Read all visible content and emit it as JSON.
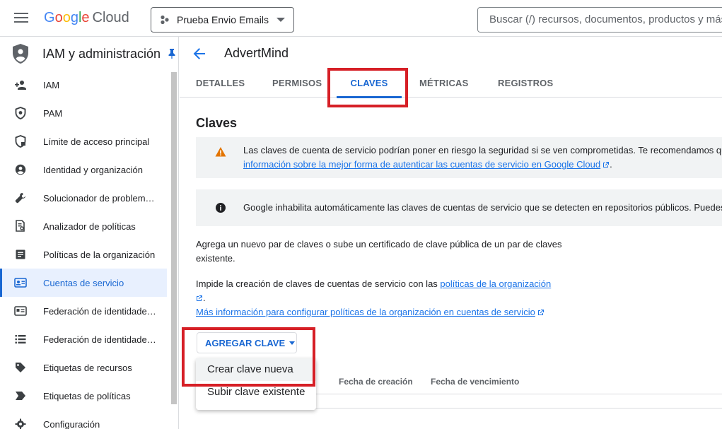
{
  "header": {
    "logo_letters": [
      "G",
      "o",
      "o",
      "g",
      "l",
      "e"
    ],
    "logo_product": "Cloud",
    "project_name": "Prueba Envio Emails",
    "search_placeholder": "Buscar (/) recursos, documentos, productos y más"
  },
  "sidebar": {
    "title": "IAM y administración",
    "items": [
      {
        "label": "IAM",
        "icon": "person-add-icon"
      },
      {
        "label": "PAM",
        "icon": "shield-check-icon"
      },
      {
        "label": "Límite de acceso principal",
        "icon": "shield-lock-icon"
      },
      {
        "label": "Identidad y organización",
        "icon": "account-circle-icon"
      },
      {
        "label": "Solucionador de problemas de políticas",
        "icon": "wrench-icon"
      },
      {
        "label": "Analizador de políticas",
        "icon": "document-search-icon"
      },
      {
        "label": "Políticas de la organización",
        "icon": "list-document-icon"
      },
      {
        "label": "Cuentas de servicio",
        "icon": "service-account-icon",
        "active": true
      },
      {
        "label": "Federación de identidades para cargas de trabajo",
        "icon": "id-card-icon"
      },
      {
        "label": "Federación de identidades de personal",
        "icon": "list-icon"
      },
      {
        "label": "Etiquetas de recursos",
        "icon": "tag-icon"
      },
      {
        "label": "Etiquetas de políticas",
        "icon": "label-arrow-icon"
      },
      {
        "label": "Configuración",
        "icon": "settings-icon"
      }
    ]
  },
  "main": {
    "account_name": "AdvertMind",
    "tabs": [
      "DETALLES",
      "PERMISOS",
      "CLAVES",
      "MÉTRICAS",
      "REGISTROS"
    ],
    "active_tab": "CLAVES",
    "section_title": "Claves",
    "warning_line1": "Las claves de cuenta de servicio podrían poner en riesgo la seguridad si se ven comprometidas. Te recomendamos que evites",
    "warning_link": "información sobre la mejor forma de autenticar las cuentas de servicio en Google Cloud",
    "warning_end": ".",
    "info_text": "Google inhabilita automáticamente las claves de cuentas de servicio que se detecten en repositorios públicos. Puedes",
    "para1_line1": "Agrega un nuevo par de claves o sube un certificado de clave pública de un par de claves",
    "para1_line2": "existente.",
    "para2_text": "Impide la creación de claves de cuentas de servicio con las ",
    "para2_link": "políticas de la organización",
    "para2_end": ".",
    "para3_link": "Más información para configurar políticas de la organización en cuentas de servicio",
    "add_key_button": "AGREGAR CLAVE",
    "dropdown_items": [
      "Crear clave nueva",
      "Subir clave existente"
    ],
    "table_headers": [
      "Fecha de creación",
      "Fecha de vencimiento"
    ]
  },
  "colors": {
    "accent": "#1967d2",
    "highlight_box": "#d61f26",
    "warning": "#e37400"
  }
}
